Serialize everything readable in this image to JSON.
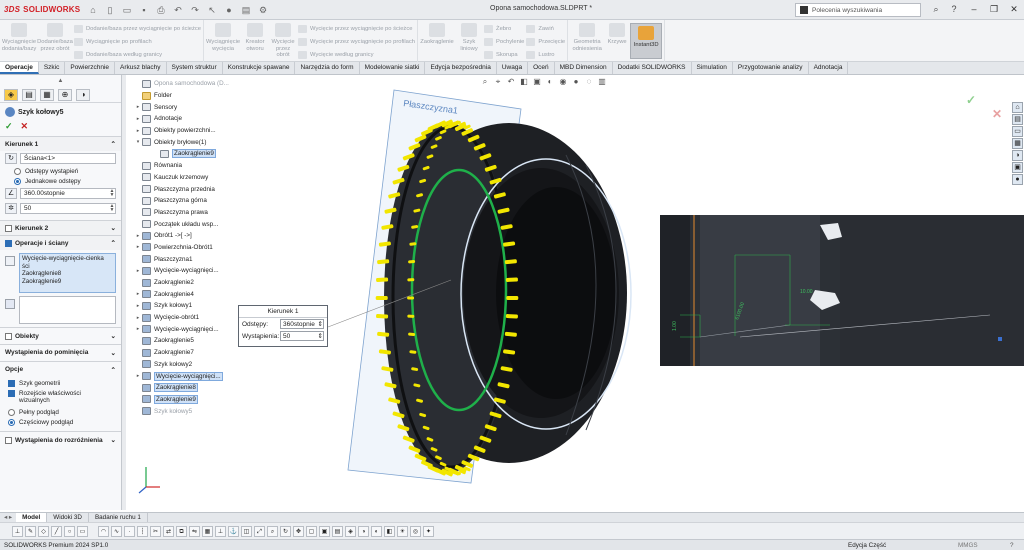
{
  "app": {
    "brand": "SOLIDWORKS",
    "brand_prefix": "3DS",
    "title": "Opona samochodowa.SLDPRT *"
  },
  "search": {
    "placeholder": "Polecenia wyszukiwania"
  },
  "ribbon": {
    "big1": "Wyciągnięcie dodania/bazy",
    "big2": "Dodanie/baza przez obrót",
    "s1": "Dodanie/baza przez wyciągnięcie po ścieżce",
    "s2": "Wyciągnięcie po profilach",
    "s3": "Dodanie/baza według granicy",
    "big3": "Wyciągnięcie wycięcia",
    "big4": "Kreator otworu",
    "big5": "Wycięcie przez obrót",
    "s4": "Wycięcie przez wyciągnięcie po ścieżce",
    "s5": "Wycięcie przez wyciągnięcie po profilach",
    "s6": "Wycięcie według granicy",
    "big6": "Zaokrąglenie",
    "big7": "Szyk liniowy",
    "s7": "Żebro",
    "s8": "Pochylenie",
    "s9": "Skorupa",
    "s10": "Zawiń",
    "s11": "Przecięcie",
    "s12": "Lustro",
    "big8": "Geometria odniesienia",
    "big9": "Krzywe",
    "big10": "Instant3D"
  },
  "tabs": [
    "Operacje",
    "Szkic",
    "Powierzchnie",
    "Arkusz blachy",
    "System struktur",
    "Konstrukcje spawane",
    "Narzędzia do form",
    "Modelowanie siatki",
    "Edycja bezpośrednia",
    "Uwaga",
    "Oceń",
    "MBD Dimension",
    "Dodatki SOLIDWORKS",
    "Simulation",
    "Przygotowanie analizy",
    "Adnotacja"
  ],
  "pm": {
    "title": "Szyk kołowy5",
    "dir1": "Kierunek 1",
    "face": "Ściana<1>",
    "opt_spacing": "Odstępy wystąpień",
    "opt_equal": "Jednakowe odstępy",
    "angle": "360.00stopnie",
    "count": "50",
    "dir2": "Kierunek 2",
    "features_faces": "Operacje i ściany",
    "list_items": [
      "Wycięcie-wyciągnięcie-cienka ści",
      "Zaokrąglenie8",
      "Zaokrąglenie9"
    ],
    "bodies": "Obiekty",
    "instances_vary": "Wystąpienia do pominięcia",
    "options": "Opcje",
    "geom_pattern": "Szyk geometrii",
    "propagate": "Rozejście właściwości wizualnych",
    "full_preview": "Pełny podgląd",
    "partial_preview": "Częściowy podgląd",
    "instances_diff": "Wystąpienia do rozróżnienia"
  },
  "tree": [
    {
      "label": "Opona samochodowa (D...",
      "dim": true
    },
    {
      "label": "Folder"
    },
    {
      "label": "Sensory"
    },
    {
      "label": "Adnotacje"
    },
    {
      "label": "Obiekty powierzchni..."
    },
    {
      "label": "Obiekty bryłowe(1)"
    },
    {
      "label": "Zaokrąglenie9",
      "sel": true
    },
    {
      "label": "Równania"
    },
    {
      "label": "Kauczuk krzemowy"
    },
    {
      "label": "Płaszczyzna przednia"
    },
    {
      "label": "Płaszczyzna górna"
    },
    {
      "label": "Płaszczyzna prawa"
    },
    {
      "label": "Początek układu wsp..."
    },
    {
      "label": "Obrót1 ->[ ->]"
    },
    {
      "label": "Powierzchnia-Obrót1"
    },
    {
      "label": "Płaszczyzna1"
    },
    {
      "label": "Wycięcie-wyciągnięci..."
    },
    {
      "label": "Zaokrąglenie2"
    },
    {
      "label": "Zaokrąglenie4"
    },
    {
      "label": "Szyk kołowy1"
    },
    {
      "label": "Wycięcie-obrót1"
    },
    {
      "label": "Wycięcie-wyciągnięci..."
    },
    {
      "label": "Zaokrąglenie5"
    },
    {
      "label": "Zaokrąglenie7"
    },
    {
      "label": "Szyk kołowy2"
    },
    {
      "label": "Wycięcie-wyciągnięci...",
      "sel": true
    },
    {
      "label": "Zaokrąglenie8",
      "sel": true
    },
    {
      "label": "Zaokrąglenie9",
      "sel": true
    },
    {
      "label": "Szyk kołowy5",
      "dim": true
    }
  ],
  "callout": {
    "title": "Kierunek 1",
    "spacing_label": "Odstępy:",
    "spacing": "360stopnie",
    "count_label": "Wystąpienia:",
    "count": "50"
  },
  "plane_label": "Płaszczyzna1",
  "detail": {
    "dim1": "10.00",
    "dim2": "1.00",
    "dim3": "6100.00"
  },
  "bottom_tabs": [
    "Model",
    "Widoki 3D",
    "Badanie ruchu 1"
  ],
  "status": {
    "left": "SOLIDWORKS Premium 2024 SP1.0",
    "mode": "Edycja Część",
    "units": "MMGS"
  },
  "colors": {
    "accent": "#2f6fb5",
    "tread_yellow": "#f2e600",
    "circle_green": "#1fb04a",
    "brand": "#d21f26"
  }
}
